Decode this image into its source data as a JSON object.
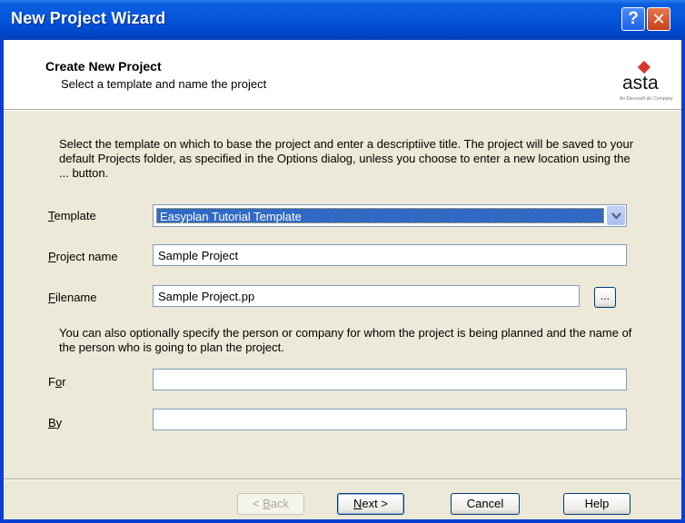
{
  "window": {
    "title": "New Project Wizard",
    "help_icon": "?",
    "close_icon": "✕"
  },
  "header": {
    "title": "Create New Project",
    "subtitle": "Select a template and name the project",
    "logo": {
      "name": "asta",
      "tagline": "An Elecosoft plc Company"
    }
  },
  "intro_text": "Select the template on which to base the project and enter a descriptiive title. The project will be saved to your default Projects folder, as specified in the Options dialog, unless you choose to enter a new location using the ... button.",
  "fields": {
    "template": {
      "label_key": "T",
      "label_rest": "emplate",
      "value": "Easyplan Tutorial Template"
    },
    "project_name": {
      "label_key": "P",
      "label_rest": "roject name",
      "value": "Sample Project"
    },
    "filename": {
      "label_key": "F",
      "label_rest": "ilename",
      "value": "Sample Project.pp",
      "browse_label": "..."
    },
    "for": {
      "label_pre": "F",
      "label_key": "o",
      "label_rest": "r",
      "value": ""
    },
    "by": {
      "label_key": "B",
      "label_rest": "y",
      "value": ""
    }
  },
  "optional_text": "You can also optionally specify the person or company for whom the project is being planned and the name of the person who is going to plan the project.",
  "buttons": {
    "back": {
      "prefix": "< ",
      "key": "B",
      "rest": "ack"
    },
    "next": {
      "key": "N",
      "rest": "ext >"
    },
    "cancel": "Cancel",
    "help": "Help"
  },
  "colors": {
    "titlebar": "#0554da",
    "dialog_bg": "#ece9d8",
    "selection": "#316ac5",
    "logo_accent": "#d8352a"
  }
}
